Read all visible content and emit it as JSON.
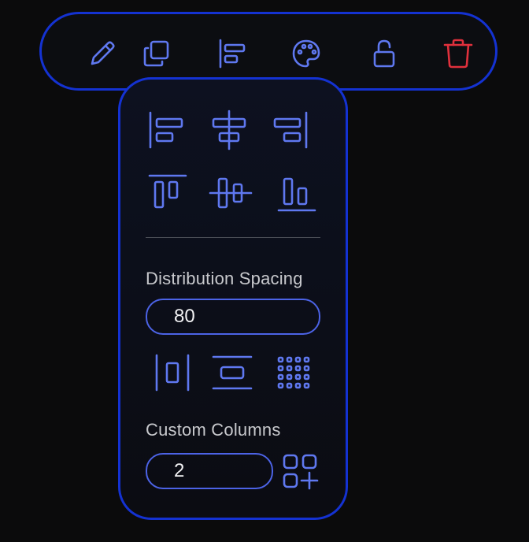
{
  "toolbar": {
    "buttons": [
      {
        "name": "edit",
        "icon": "pencil-icon"
      },
      {
        "name": "duplicate",
        "icon": "copy-icon"
      },
      {
        "name": "align",
        "icon": "align-left-icon"
      },
      {
        "name": "color",
        "icon": "palette-icon"
      },
      {
        "name": "lock",
        "icon": "unlock-icon"
      },
      {
        "name": "delete",
        "icon": "trash-icon",
        "color": "#e0303c"
      }
    ]
  },
  "panel": {
    "align_buttons": [
      {
        "name": "align-left",
        "icon": "align-left-icon"
      },
      {
        "name": "align-center-horizontal",
        "icon": "align-center-horizontal-icon"
      },
      {
        "name": "align-right",
        "icon": "align-right-icon"
      },
      {
        "name": "align-top",
        "icon": "align-top-icon"
      },
      {
        "name": "align-middle-vertical",
        "icon": "align-middle-vertical-icon"
      },
      {
        "name": "align-bottom",
        "icon": "align-bottom-icon"
      }
    ],
    "distribution_label": "Distribution Spacing",
    "distribution_value": "80",
    "distribute_buttons": [
      {
        "name": "distribute-horizontal",
        "icon": "distribute-horizontal-icon"
      },
      {
        "name": "distribute-vertical",
        "icon": "distribute-vertical-icon"
      },
      {
        "name": "grid-layout",
        "icon": "grid-dots-icon"
      }
    ],
    "columns_label": "Custom Columns",
    "columns_value": "2",
    "add_columns_icon": "grid-add-icon"
  },
  "colors": {
    "accent": "#1432d2",
    "icon": "#5f78f0",
    "danger": "#e0303c",
    "background": "#0b0b0c"
  }
}
